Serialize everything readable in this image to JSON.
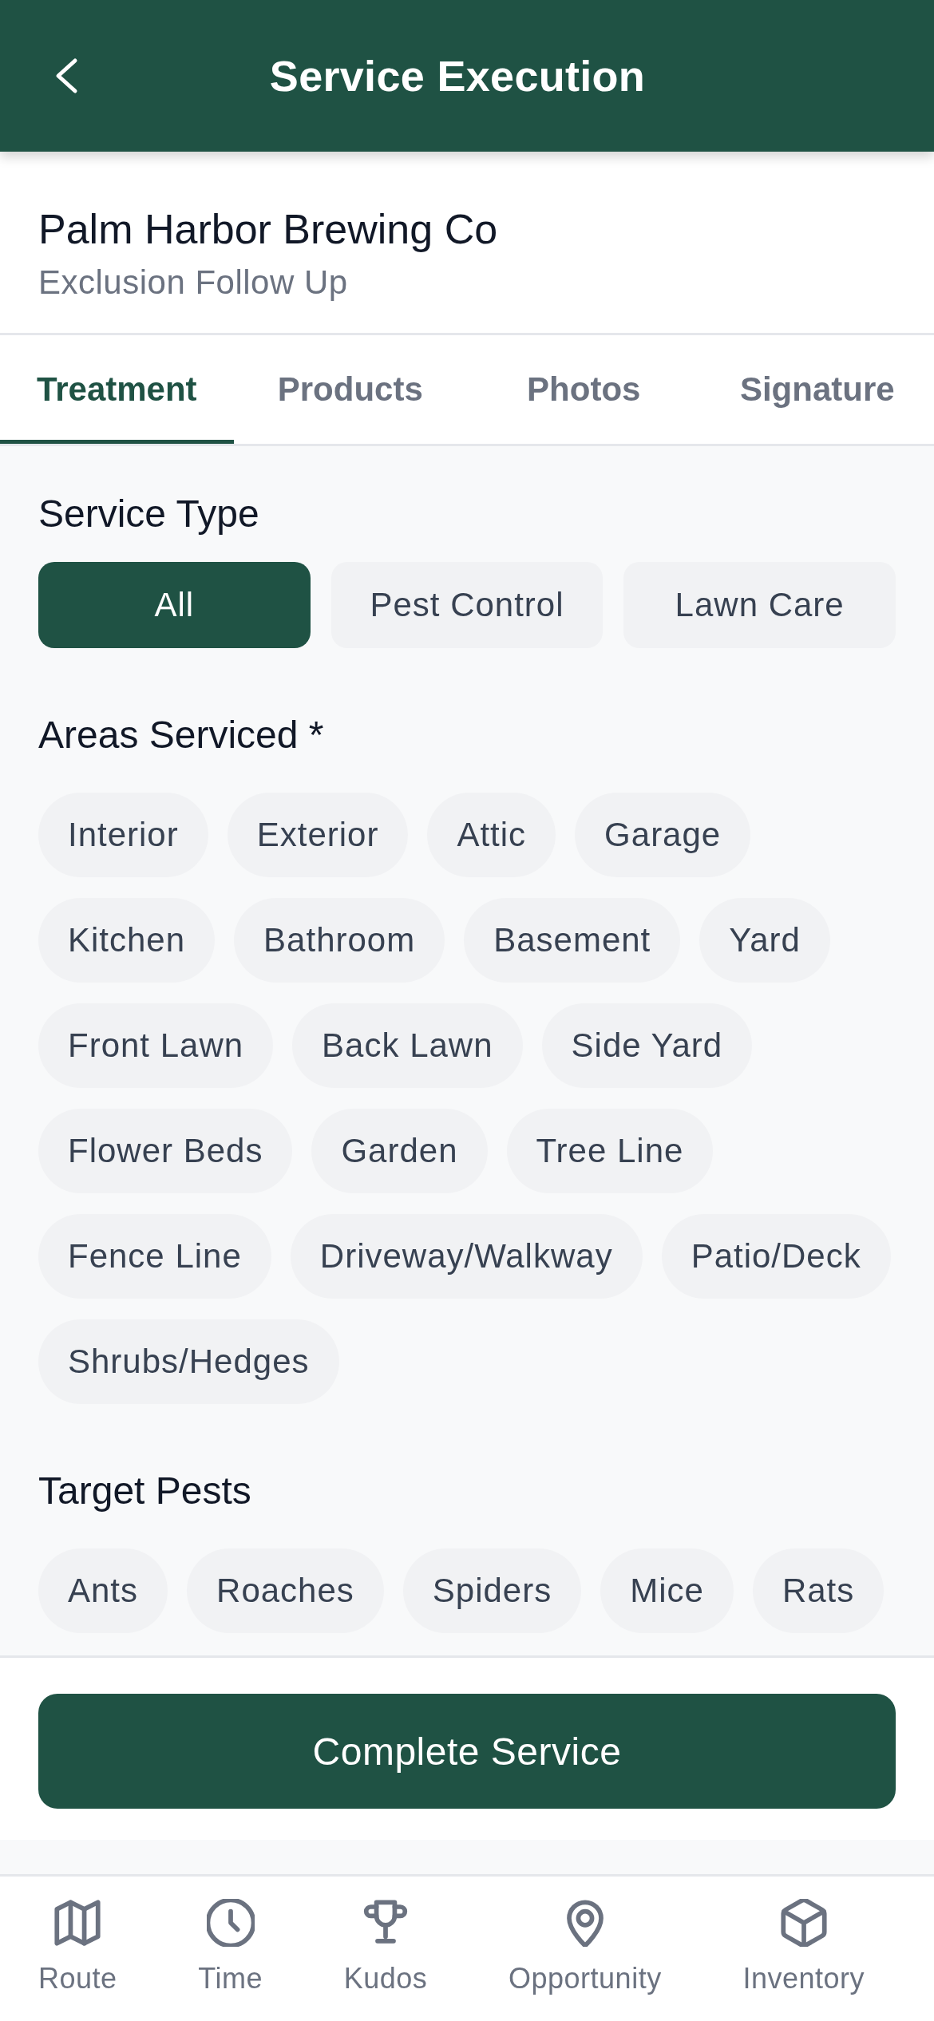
{
  "header": {
    "title": "Service Execution"
  },
  "customer": {
    "name": "Palm Harbor Brewing Co",
    "service": "Exclusion Follow Up"
  },
  "tabs": [
    {
      "label": "Treatment",
      "selected": true
    },
    {
      "label": "Products",
      "selected": false
    },
    {
      "label": "Photos",
      "selected": false
    },
    {
      "label": "Signature",
      "selected": false
    }
  ],
  "sections": [
    {
      "kind": "segmented",
      "title": "Service Type",
      "options": [
        {
          "label": "All",
          "selected": true
        },
        {
          "label": "Pest Control",
          "selected": false
        },
        {
          "label": "Lawn Care",
          "selected": false
        }
      ]
    },
    {
      "kind": "chips",
      "title": "Areas Serviced *",
      "options": [
        {
          "label": "Interior",
          "selected": false
        },
        {
          "label": "Exterior",
          "selected": false
        },
        {
          "label": "Attic",
          "selected": false
        },
        {
          "label": "Garage",
          "selected": false
        },
        {
          "label": "Kitchen",
          "selected": false
        },
        {
          "label": "Bathroom",
          "selected": false
        },
        {
          "label": "Basement",
          "selected": false
        },
        {
          "label": "Yard",
          "selected": false
        },
        {
          "label": "Front Lawn",
          "selected": false
        },
        {
          "label": "Back Lawn",
          "selected": false
        },
        {
          "label": "Side Yard",
          "selected": false
        },
        {
          "label": "Flower Beds",
          "selected": false
        },
        {
          "label": "Garden",
          "selected": false
        },
        {
          "label": "Tree Line",
          "selected": false
        },
        {
          "label": "Fence Line",
          "selected": false
        },
        {
          "label": "Driveway/Walkway",
          "selected": false
        },
        {
          "label": "Patio/Deck",
          "selected": false
        },
        {
          "label": "Shrubs/Hedges",
          "selected": false
        }
      ]
    },
    {
      "kind": "chips",
      "title": "Target Pests",
      "options": [
        {
          "label": "Ants",
          "selected": false
        },
        {
          "label": "Roaches",
          "selected": false
        },
        {
          "label": "Spiders",
          "selected": false
        },
        {
          "label": "Mice",
          "selected": false
        },
        {
          "label": "Rats",
          "selected": false
        }
      ]
    }
  ],
  "primary_action": {
    "label": "Complete Service"
  },
  "bottom_nav": [
    {
      "label": "Route",
      "selected": false
    },
    {
      "label": "Time",
      "selected": false
    },
    {
      "label": "Kudos",
      "selected": false
    },
    {
      "label": "Opportunity",
      "selected": false
    },
    {
      "label": "Inventory",
      "selected": false
    }
  ]
}
